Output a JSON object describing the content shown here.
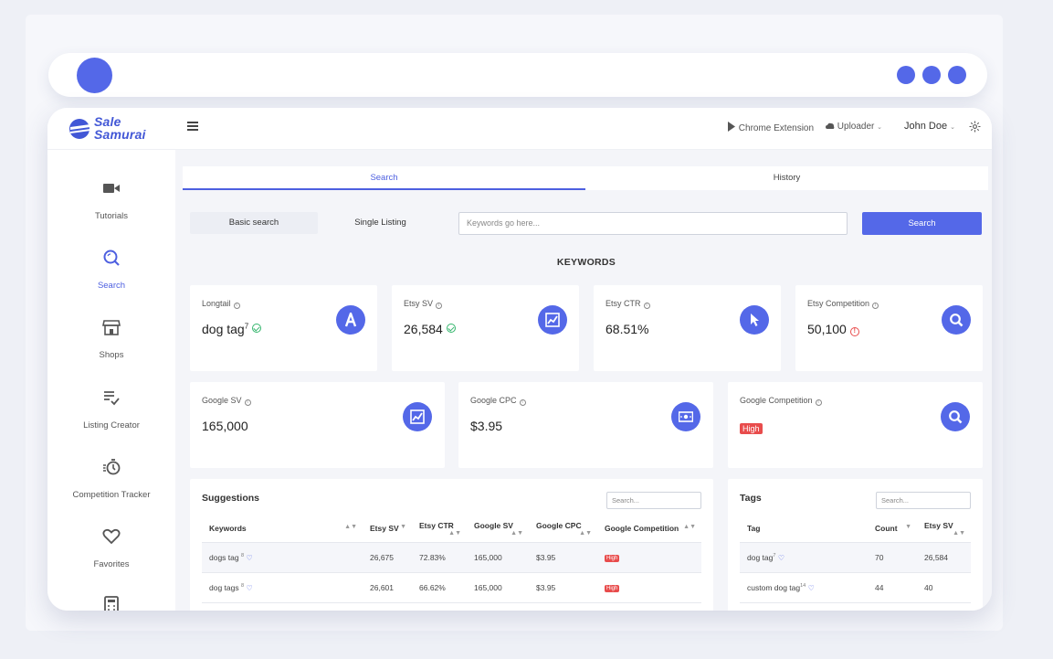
{
  "brand": {
    "name_line1": "Sale",
    "name_line2": "Samurai",
    "color": "#4257d6"
  },
  "accent": "#5468e8",
  "topbar": {
    "chrome_extension": "Chrome Extension",
    "uploader": "Uploader",
    "user": "John Doe"
  },
  "sidebar": {
    "items": [
      {
        "label": "Tutorials",
        "icon": "video-camera-icon"
      },
      {
        "label": "Search",
        "icon": "search-icon",
        "active": true
      },
      {
        "label": "Shops",
        "icon": "store-icon"
      },
      {
        "label": "Listing Creator",
        "icon": "list-edit-icon"
      },
      {
        "label": "Competition Tracker",
        "icon": "stopwatch-icon"
      },
      {
        "label": "Favorites",
        "icon": "heart-icon"
      }
    ]
  },
  "tabs": [
    {
      "label": "Search",
      "active": true
    },
    {
      "label": "History"
    }
  ],
  "modes": {
    "basic": "Basic search",
    "single": "Single Listing"
  },
  "search": {
    "placeholder": "Keywords go here...",
    "button": "Search"
  },
  "keywords_title": "KEYWORDS",
  "metrics": {
    "longtail": {
      "label": "Longtail",
      "value": "dog tag",
      "sup": "7"
    },
    "etsy_sv": {
      "label": "Etsy SV",
      "value": "26,584"
    },
    "etsy_ctr": {
      "label": "Etsy CTR",
      "value": "68.51%"
    },
    "etsy_comp": {
      "label": "Etsy Competition",
      "value": "50,100"
    },
    "google_sv": {
      "label": "Google SV",
      "value": "165,000"
    },
    "google_cpc": {
      "label": "Google CPC",
      "value": "$3.95"
    },
    "google_comp": {
      "label": "Google Competition",
      "value": "High"
    }
  },
  "suggestions": {
    "title": "Suggestions",
    "search_placeholder": "Search...",
    "columns": [
      "Keywords",
      "Etsy SV",
      "Etsy CTR",
      "Google SV",
      "Google CPC",
      "Google Competition"
    ],
    "rows": [
      {
        "keyword": "dogs tag",
        "sup": "8",
        "etsy_sv": "26,675",
        "etsy_ctr": "72.83%",
        "google_sv": "165,000",
        "google_cpc": "$3.95",
        "competition": "High"
      },
      {
        "keyword": "dog tags",
        "sup": "8",
        "etsy_sv": "26,601",
        "etsy_ctr": "66.62%",
        "google_sv": "165,000",
        "google_cpc": "$3.95",
        "competition": "High"
      }
    ]
  },
  "tags": {
    "title": "Tags",
    "search_placeholder": "Search...",
    "columns": [
      "Tag",
      "Count",
      "Etsy SV"
    ],
    "rows": [
      {
        "tag": "dog tag",
        "sup": "7",
        "count": "70",
        "etsy_sv": "26,584"
      },
      {
        "tag": "custom dog tag",
        "sup": "14",
        "count": "44",
        "etsy_sv": "40"
      }
    ]
  }
}
